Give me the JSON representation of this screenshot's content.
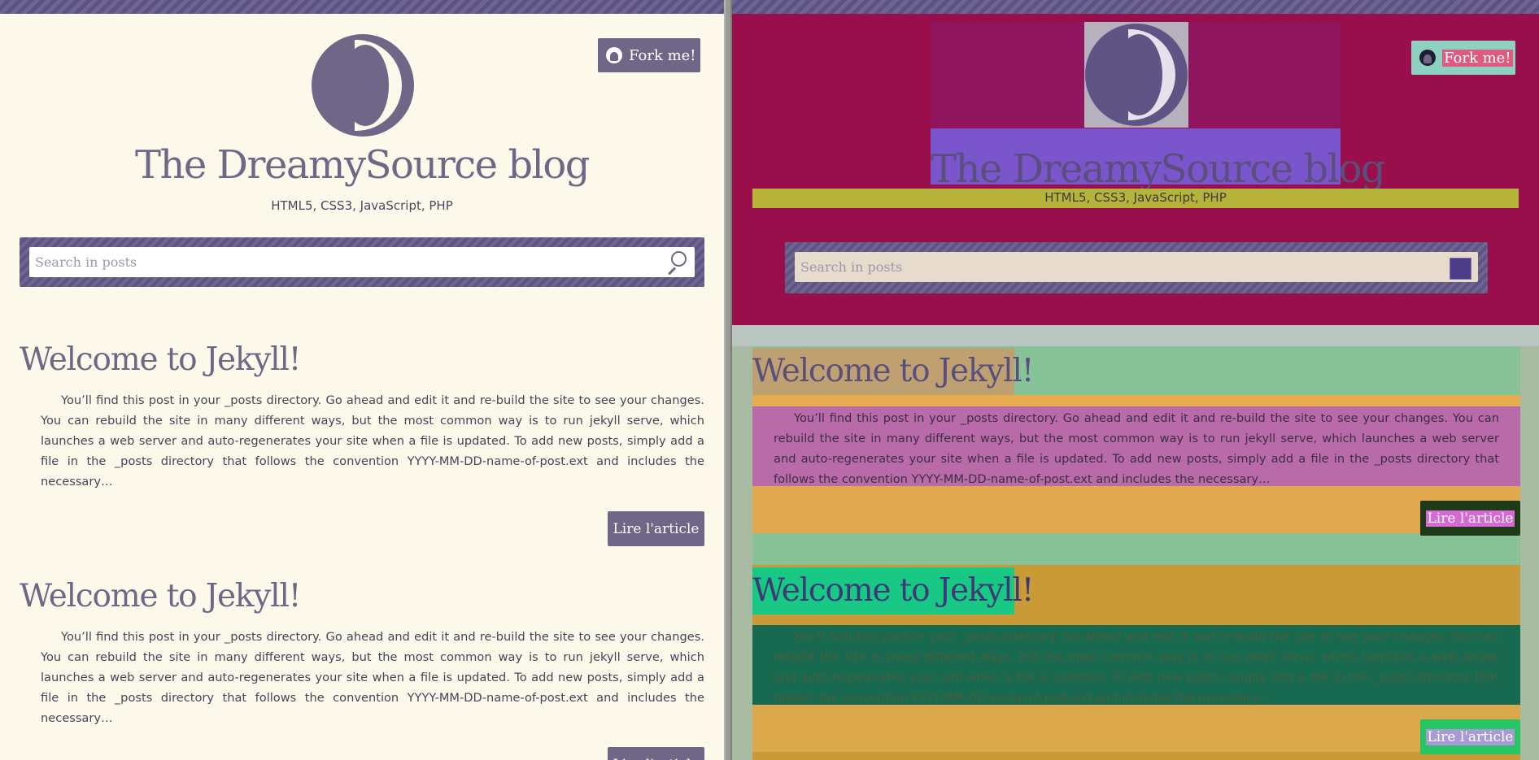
{
  "blog": {
    "title": "The DreamySource blog",
    "tagline": "HTML5, CSS3, JavaScript, PHP",
    "fork_label": "Fork me!",
    "search_placeholder": "Search in posts"
  },
  "posts": [
    {
      "title": "Welcome to Jekyll!",
      "excerpt": "You’ll find this post in your _posts directory. Go ahead and edit it and re-build the site to see your changes. You can rebuild the site in many different ways, but the most common way is to run jekyll serve, which launches a web server and auto-regenerates your site when a file is updated. To add new posts, simply add a file in the _posts directory that follows the convention YYYY-MM-DD-name-of-post.ext and includes the necessary…",
      "read_more_label": "Lire l'article"
    },
    {
      "title": "Welcome to Jekyll!",
      "excerpt": "You’ll find this post in your _posts directory. Go ahead and edit it and re-build the site to see your changes. You can rebuild the site in many different ways, but the most common way is to run jekyll serve, which launches a web server and auto-regenerates your site when a file is updated. To add new posts, simply add a file in the _posts directory that follows the convention YYYY-MM-DD-name-of-post.ext and includes the necessary…",
      "read_more_label": "Lire l'article"
    }
  ],
  "colors": {
    "brand": "#6f6688",
    "page_background": "#fdf9ea",
    "debug_header": "#990f4c",
    "debug_title": "#7b55cb",
    "debug_tagline": "#b6b33a",
    "debug_post_footer": "#e2a84f"
  },
  "icons": {
    "logo": "crescent-moon-logo",
    "fork": "github-icon",
    "search": "magnifier-icon"
  }
}
